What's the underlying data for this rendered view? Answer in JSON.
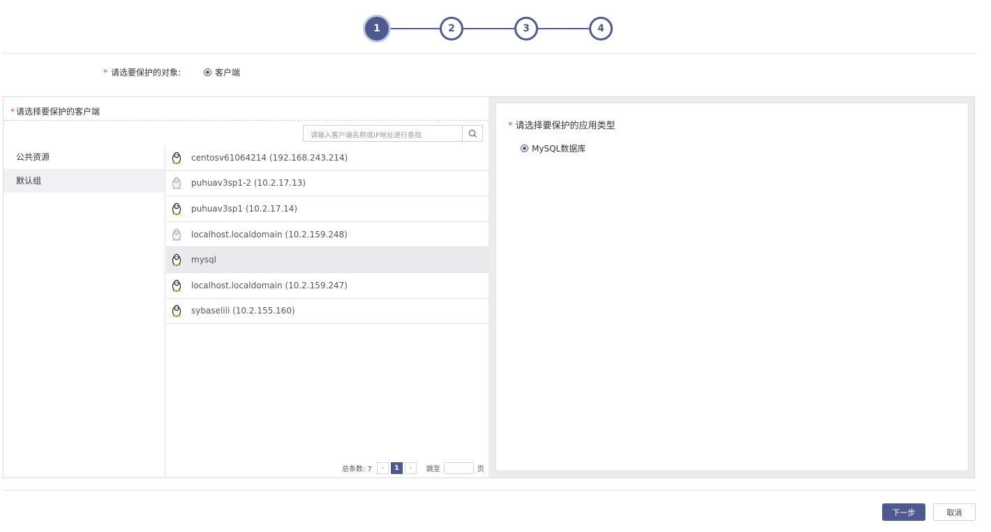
{
  "stepper": {
    "steps": [
      "1",
      "2",
      "3",
      "4"
    ],
    "active_step": 1
  },
  "target": {
    "label": "请选要保护的对象:",
    "option": "客户端",
    "required_mark": "*"
  },
  "left_panel": {
    "title": "请选择要保护的客户端",
    "search_placeholder": "请输入客户端名称或IP地址进行查找",
    "groups": [
      "公共资源",
      "默认组"
    ],
    "selected_group": "默认组",
    "clients": [
      {
        "label": "centosv61064214 (192.168.243.214)",
        "online": true
      },
      {
        "label": "puhuav3sp1-2 (10.2.17.13)",
        "online": false
      },
      {
        "label": "puhuav3sp1 (10.2.17.14)",
        "online": true
      },
      {
        "label": "localhost.localdomain (10.2.159.248)",
        "online": false
      },
      {
        "label": "mysql",
        "online": true
      },
      {
        "label": "localhost.localdomain (10.2.159.247)",
        "online": true
      },
      {
        "label": "sybaselili (10.2.155.160)",
        "online": true
      }
    ],
    "selected_client": "mysql",
    "pager": {
      "total_label": "总条数: 7",
      "current_page": "1",
      "jump_label": "跳至",
      "page_suffix": "页"
    }
  },
  "right_panel": {
    "title": "请选择要保护的应用类型",
    "option": "MySQL数据库"
  },
  "footer": {
    "next_label": "下一步",
    "cancel_label": "取消"
  },
  "colors": {
    "accent": "#4e5a8f",
    "required": "#e8462c"
  }
}
